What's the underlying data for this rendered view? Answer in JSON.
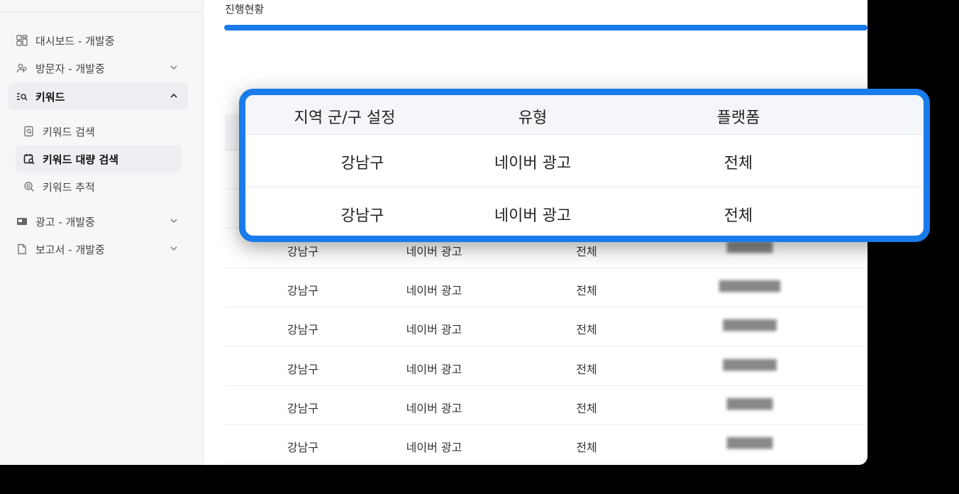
{
  "sidebar": {
    "items": [
      {
        "label": "대시보드 - 개발중",
        "icon": "dashboard-icon",
        "expandable": false
      },
      {
        "label": "방문자 - 개발중",
        "icon": "users-icon",
        "expandable": true
      },
      {
        "label": "키워드",
        "icon": "keyword-search-icon",
        "expandable": true,
        "active": true
      },
      {
        "label": "광고 - 개발중",
        "icon": "ad-icon",
        "expandable": true
      },
      {
        "label": "보고서 - 개발중",
        "icon": "document-icon",
        "expandable": true
      }
    ],
    "sub_items": [
      {
        "label": "키워드 검색",
        "icon": "search-doc-icon"
      },
      {
        "label": "키워드 대량 검색",
        "icon": "calendar-search-icon",
        "active": true
      },
      {
        "label": "키워드 추적",
        "icon": "zoom-icon"
      }
    ]
  },
  "progress": {
    "title": "진행현황",
    "percent": 100,
    "color": "#1a7bea"
  },
  "table": {
    "rows": [
      {
        "region": "강남구",
        "type": "네이버 광고",
        "platform": "전체",
        "keyword": "██████"
      },
      {
        "region": "강남구",
        "type": "네이버 광고",
        "platform": "전체",
        "keyword": "████████"
      },
      {
        "region": "강남구",
        "type": "네이버 광고",
        "platform": "전체",
        "keyword": "███████"
      },
      {
        "region": "강남구",
        "type": "네이버 광고",
        "platform": "전체",
        "keyword": "███████"
      },
      {
        "region": "강남구",
        "type": "네이버 광고",
        "platform": "전체",
        "keyword": "██████"
      },
      {
        "region": "강남구",
        "type": "네이버 광고",
        "platform": "전체",
        "keyword": "██████"
      }
    ]
  },
  "zoom": {
    "headers": {
      "region": "지역 군/구 설정",
      "type": "유형",
      "platform": "플랫폼"
    },
    "rows": [
      {
        "region": "강남구",
        "type": "네이버 광고",
        "platform": "전체"
      },
      {
        "region": "강남구",
        "type": "네이버 광고",
        "platform": "전체"
      }
    ],
    "accent": "#1a7bea"
  }
}
